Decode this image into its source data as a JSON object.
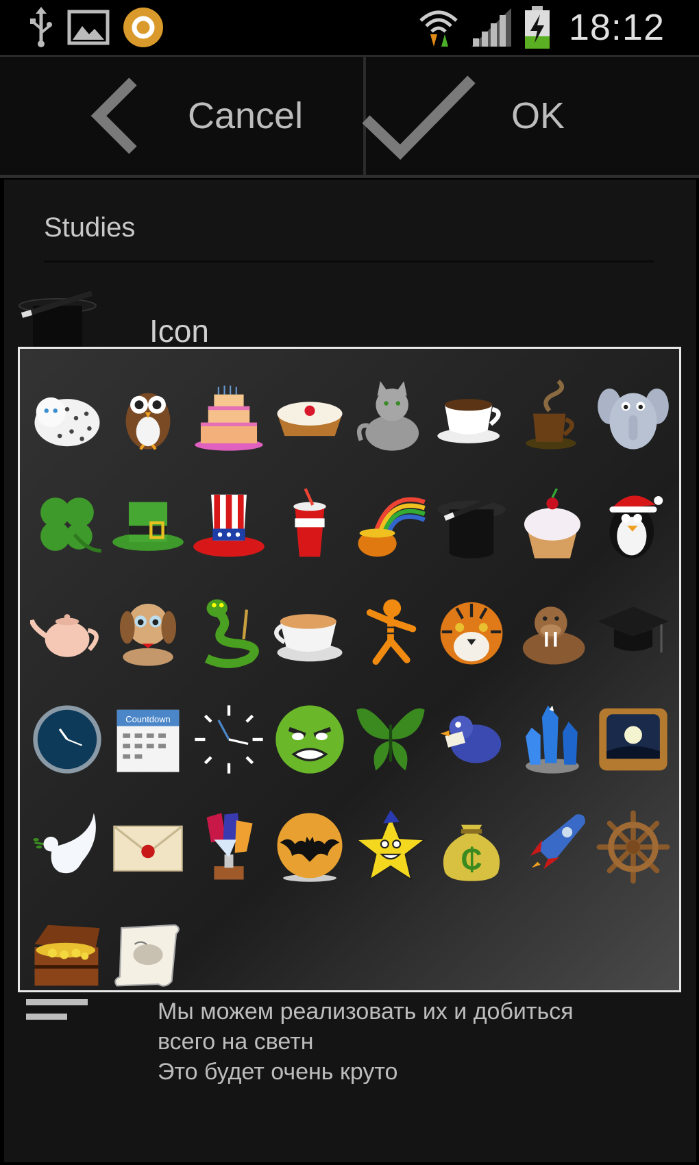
{
  "status_bar": {
    "time": "18:12",
    "left_icons": [
      "usb-icon",
      "image-icon",
      "app-notification-icon"
    ],
    "right_icons": [
      "wifi-icon",
      "signal-icon",
      "battery-charging-icon"
    ]
  },
  "action_bar": {
    "cancel_label": "Cancel",
    "ok_label": "OK"
  },
  "form": {
    "section_title": "Studies",
    "icon_label": "Icon",
    "description_lines": [
      "Мы можем реализовать их и добиться",
      "всего на светн",
      "Это будет очень круто"
    ]
  },
  "icon_picker": {
    "icons": [
      "snow-leopard-icon",
      "owl-icon",
      "birthday-cake-icon",
      "tart-icon",
      "cat-icon",
      "coffee-cup-icon",
      "hot-coffee-mug-icon",
      "elephant-icon",
      "clover-icon",
      "leprechaun-hat-icon",
      "uncle-sam-hat-icon",
      "soda-cup-icon",
      "pot-of-gold-rainbow-icon",
      "magic-hat-icon",
      "cupcake-icon",
      "penguin-santa-icon",
      "teapot-icon",
      "puppy-icon",
      "snake-icon",
      "tea-cup-icon",
      "tiger-cartoon-icon",
      "tiger-face-icon",
      "walrus-icon",
      "graduation-cap-icon",
      "wall-clock-icon",
      "countdown-calendar-icon",
      "clock-face-icon",
      "angry-smiley-icon",
      "butterfly-icon",
      "bird-letter-icon",
      "crystal-icon",
      "tv-icon",
      "dove-icon",
      "envelope-icon",
      "trophy-gems-icon",
      "bat-emblem-icon",
      "star-face-icon",
      "money-bag-icon",
      "rocket-icon",
      "ship-wheel-icon",
      "treasure-chest-icon",
      "treasure-map-icon"
    ],
    "calendar_text": "Countdown"
  }
}
